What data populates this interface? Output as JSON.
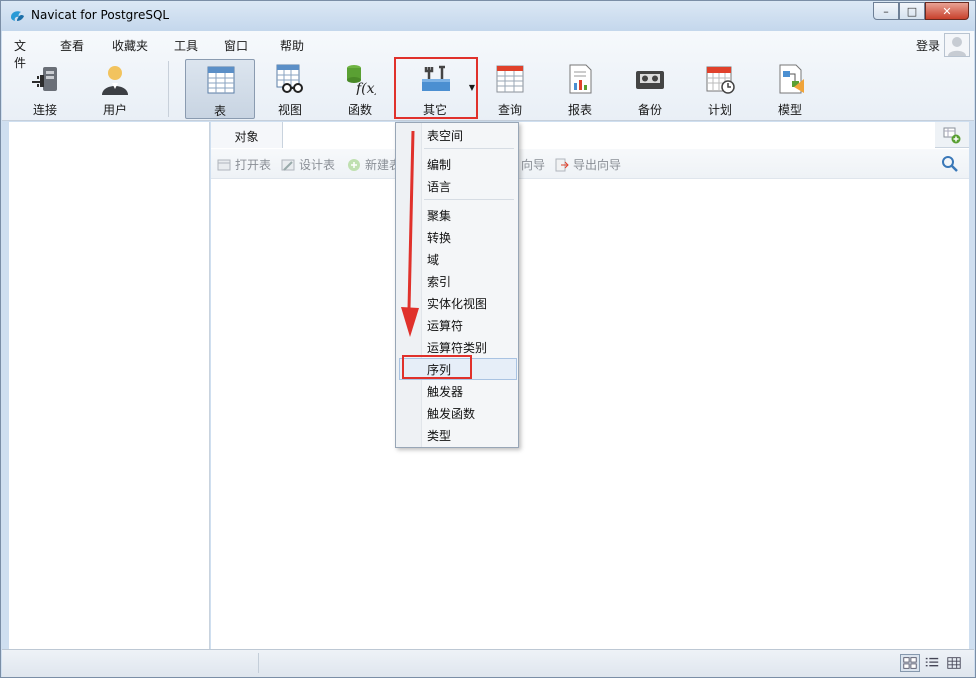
{
  "window": {
    "title": "Navicat for PostgreSQL",
    "controls": {
      "minimize": "–",
      "maximize": "□",
      "close": "✕"
    }
  },
  "menubar": {
    "items": [
      "文件",
      "查看",
      "收藏夹",
      "工具",
      "窗口",
      "帮助"
    ],
    "login": "登录"
  },
  "toolbar": {
    "items": [
      {
        "label": "连接",
        "icon": "plug-icon"
      },
      {
        "label": "用户",
        "icon": "user-icon"
      },
      {
        "label": "表",
        "icon": "table-icon",
        "active": true
      },
      {
        "label": "视图",
        "icon": "glasses-view-icon"
      },
      {
        "label": "函数",
        "icon": "function-icon"
      },
      {
        "label": "其它",
        "icon": "tools-icon",
        "dropdown": true,
        "highlighted": true
      },
      {
        "label": "查询",
        "icon": "query-icon"
      },
      {
        "label": "报表",
        "icon": "report-icon"
      },
      {
        "label": "备份",
        "icon": "backup-tape-icon"
      },
      {
        "label": "计划",
        "icon": "calendar-clock-icon"
      },
      {
        "label": "模型",
        "icon": "model-icon"
      }
    ]
  },
  "tabs": {
    "object_label": "对象"
  },
  "object_toolbar": {
    "buttons": [
      {
        "label": "打开表",
        "icon": "open-table-icon"
      },
      {
        "label": "设计表",
        "icon": "design-table-icon"
      },
      {
        "label": "新建表",
        "icon": "new-table-icon"
      },
      {
        "label": "向导",
        "icon": "import-wizard-icon"
      },
      {
        "label": "导出向导",
        "icon": "export-wizard-icon"
      }
    ]
  },
  "dropdown_menu": {
    "items": [
      "表空间",
      "编制",
      "语言",
      "聚集",
      "转换",
      "域",
      "索引",
      "实体化视图",
      "运算符",
      "运算符类别",
      "序列",
      "触发器",
      "触发函数",
      "类型"
    ],
    "highlighted_item": "序列"
  },
  "colors": {
    "annotation_red": "#e0312b",
    "window_frame": "#cfdff0",
    "menu_background": "#f4f6f8"
  }
}
